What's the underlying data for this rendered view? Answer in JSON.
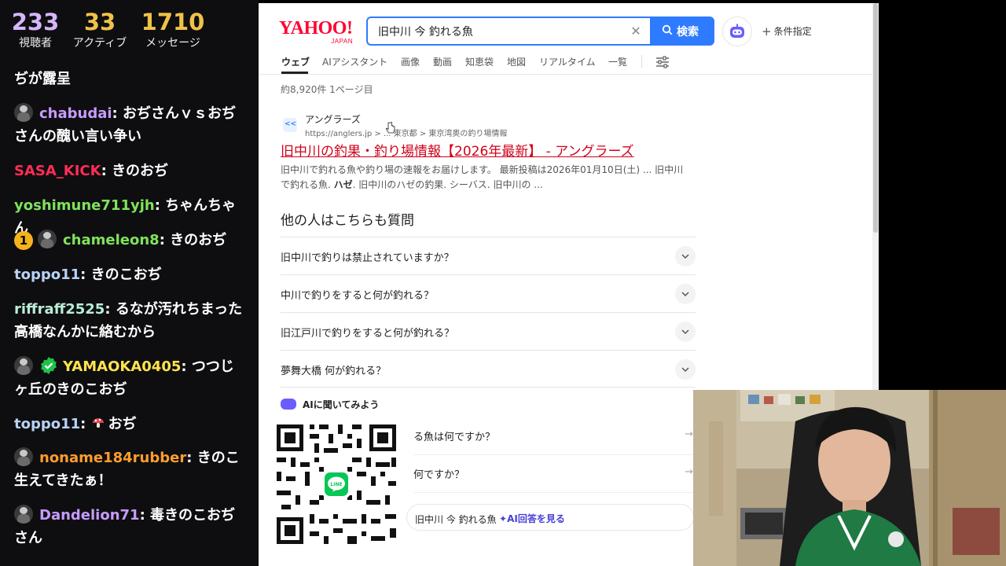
{
  "stats": {
    "viewers": {
      "value": "233",
      "label": "視聴者"
    },
    "active": {
      "value": "33",
      "label": "アクティブ"
    },
    "messages": {
      "value": "1710",
      "label": "メッセージ"
    }
  },
  "chat": [
    {
      "user": "",
      "text": "ぢが露呈",
      "color": "#ffffff"
    },
    {
      "user": "chabudai",
      "text": "おぢさんｖｓおぢさんの醜い言い争い",
      "color": "#c79bff"
    },
    {
      "user": "SASA_KICK",
      "text": "きのおぢ",
      "color": "#ff2d55"
    },
    {
      "user": "yoshimune711yjh",
      "text": "ちゃんちゃん",
      "color": "#7fe35b"
    },
    {
      "user": "chameleon8",
      "text": "きのおぢ",
      "color": "#7fe35b",
      "badge": "1"
    },
    {
      "user": "toppo11",
      "text": "きのこおぢ",
      "color": "#b9d3f5"
    },
    {
      "user": "riffraff2525",
      "text": "るなが汚れちまった高橋なんかに絡むから",
      "color": "#b9eed8"
    },
    {
      "user": "YAMAOKA0405",
      "text": "つつじヶ丘のきのこおぢ",
      "color": "#ffe44d"
    },
    {
      "user": "toppo11",
      "text": "おぢ",
      "color": "#b9d3f5"
    },
    {
      "user": "noname184rubber",
      "text": "きのこ生えてきたぁ！",
      "color": "#ff9d2e"
    },
    {
      "user": "Dandelion71",
      "text": "毒きのこおぢさん",
      "color": "#c79bff"
    }
  ],
  "search": {
    "logo": "YAHOO!",
    "logo_sub": "JAPAN",
    "query": "旧中川 今 釣れる魚",
    "button": "検索",
    "conditions": "条件指定"
  },
  "tabs": [
    "ウェブ",
    "AIアシスタント",
    "画像",
    "動画",
    "知恵袋",
    "地図",
    "リアルタイム",
    "一覧"
  ],
  "result_count": "約8,920件  1ページ目",
  "result": {
    "site_name": "アングラーズ",
    "url": "https://anglers.jp > ... 東京都 > 東京湾奥の釣り場情報",
    "title": "旧中川の釣果・釣り場情報【2026年最新】 - アングラーズ",
    "snippet_a": "旧中川で釣れる魚や釣り場の速報をお届けします。 最新投稿は2026年01月10日(土) ... 旧中川で釣れる魚.",
    "snippet_bold": "ハゼ",
    "snippet_b": ". 旧中川のハゼの釣果. シーバス. 旧中川の ..."
  },
  "paa": {
    "title": "他の人はこちらも質問",
    "questions": [
      "旧中川で釣りは禁止されていますか？",
      "中川で釣りをすると何が釣れる？",
      "旧江戸川で釣りをすると何が釣れる？",
      "夢舞大橋 何が釣れる？"
    ]
  },
  "ai": {
    "heading": "AIに聞いてみよう",
    "questions": [
      "る魚は何ですか？",
      "何ですか？"
    ],
    "pill_query": "旧中川 今 釣れる魚",
    "pill_link": "AI回答を見る"
  },
  "colors": {
    "accent": "#2f7bff",
    "link": "#d0021b",
    "ai": "#4a3fd6"
  }
}
